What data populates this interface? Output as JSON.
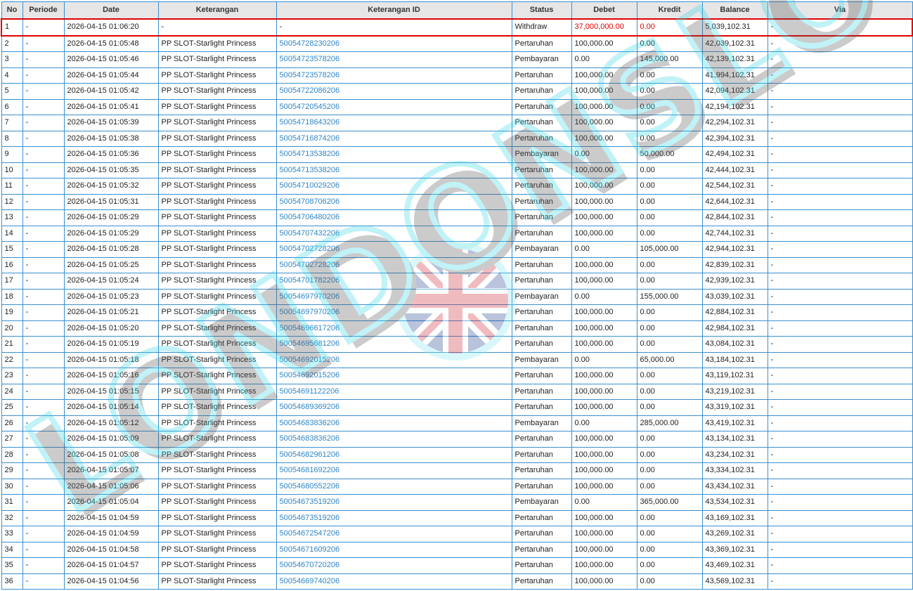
{
  "columns": [
    "No",
    "Periode",
    "Date",
    "Keterangan",
    "Keterangan ID",
    "Status",
    "Debet",
    "Kredit",
    "Balance",
    "Via"
  ],
  "rows": [
    {
      "no": "1",
      "periode": "-",
      "date": "2026-04-15 01:06:20",
      "ket": "-",
      "ket_id": "-",
      "status": "Withdraw",
      "debet": "37,000,000.00",
      "kredit": "0.00",
      "balance": "5,039,102.31",
      "via": "-"
    },
    {
      "no": "2",
      "periode": "-",
      "date": "2026-04-15 01:05:48",
      "ket": "PP SLOT-Starlight Princess",
      "ket_id": "50054728230206",
      "status": "Pertaruhan",
      "debet": "100,000.00",
      "kredit": "0.00",
      "balance": "42,039,102.31",
      "via": "-"
    },
    {
      "no": "3",
      "periode": "-",
      "date": "2026-04-15 01:05:46",
      "ket": "PP SLOT-Starlight Princess",
      "ket_id": "50054723578206",
      "status": "Pembayaran",
      "debet": "0.00",
      "kredit": "145,000.00",
      "balance": "42,139,102.31",
      "via": "-"
    },
    {
      "no": "4",
      "periode": "-",
      "date": "2026-04-15 01:05:44",
      "ket": "PP SLOT-Starlight Princess",
      "ket_id": "50054723578206",
      "status": "Pertaruhan",
      "debet": "100,000.00",
      "kredit": "0.00",
      "balance": "41,994,102.31",
      "via": "-"
    },
    {
      "no": "5",
      "periode": "-",
      "date": "2026-04-15 01:05:42",
      "ket": "PP SLOT-Starlight Princess",
      "ket_id": "50054722086206",
      "status": "Pertaruhan",
      "debet": "100,000.00",
      "kredit": "0.00",
      "balance": "42,094,102.31",
      "via": "-"
    },
    {
      "no": "6",
      "periode": "-",
      "date": "2026-04-15 01:05:41",
      "ket": "PP SLOT-Starlight Princess",
      "ket_id": "50054720545206",
      "status": "Pertaruhan",
      "debet": "100,000.00",
      "kredit": "0.00",
      "balance": "42,194,102.31",
      "via": "-"
    },
    {
      "no": "7",
      "periode": "-",
      "date": "2026-04-15 01:05:39",
      "ket": "PP SLOT-Starlight Princess",
      "ket_id": "50054718643206",
      "status": "Pertaruhan",
      "debet": "100,000.00",
      "kredit": "0.00",
      "balance": "42,294,102.31",
      "via": "-"
    },
    {
      "no": "8",
      "periode": "-",
      "date": "2026-04-15 01:05:38",
      "ket": "PP SLOT-Starlight Princess",
      "ket_id": "50054716874206",
      "status": "Pertaruhan",
      "debet": "100,000.00",
      "kredit": "0.00",
      "balance": "42,394,102.31",
      "via": "-"
    },
    {
      "no": "9",
      "periode": "-",
      "date": "2026-04-15 01:05:36",
      "ket": "PP SLOT-Starlight Princess",
      "ket_id": "50054713538206",
      "status": "Pembayaran",
      "debet": "0.00",
      "kredit": "50,000.00",
      "balance": "42,494,102.31",
      "via": "-"
    },
    {
      "no": "10",
      "periode": "-",
      "date": "2026-04-15 01:05:35",
      "ket": "PP SLOT-Starlight Princess",
      "ket_id": "50054713538206",
      "status": "Pertaruhan",
      "debet": "100,000.00",
      "kredit": "0.00",
      "balance": "42,444,102.31",
      "via": "-"
    },
    {
      "no": "11",
      "periode": "-",
      "date": "2026-04-15 01:05:32",
      "ket": "PP SLOT-Starlight Princess",
      "ket_id": "50054710029206",
      "status": "Pertaruhan",
      "debet": "100,000.00",
      "kredit": "0.00",
      "balance": "42,544,102.31",
      "via": "-"
    },
    {
      "no": "12",
      "periode": "-",
      "date": "2026-04-15 01:05:31",
      "ket": "PP SLOT-Starlight Princess",
      "ket_id": "50054708706206",
      "status": "Pertaruhan",
      "debet": "100,000.00",
      "kredit": "0.00",
      "balance": "42,644,102.31",
      "via": "-"
    },
    {
      "no": "13",
      "periode": "-",
      "date": "2026-04-15 01:05:29",
      "ket": "PP SLOT-Starlight Princess",
      "ket_id": "50054706480206",
      "status": "Pertaruhan",
      "debet": "100,000.00",
      "kredit": "0.00",
      "balance": "42,844,102.31",
      "via": "-"
    },
    {
      "no": "14",
      "periode": "-",
      "date": "2026-04-15 01:05:29",
      "ket": "PP SLOT-Starlight Princess",
      "ket_id": "50054707432206",
      "status": "Pertaruhan",
      "debet": "100,000.00",
      "kredit": "0.00",
      "balance": "42,744,102.31",
      "via": "-"
    },
    {
      "no": "15",
      "periode": "-",
      "date": "2026-04-15 01:05:28",
      "ket": "PP SLOT-Starlight Princess",
      "ket_id": "50054702728206",
      "status": "Pembayaran",
      "debet": "0.00",
      "kredit": "105,000.00",
      "balance": "42,944,102.31",
      "via": "-"
    },
    {
      "no": "16",
      "periode": "-",
      "date": "2026-04-15 01:05:25",
      "ket": "PP SLOT-Starlight Princess",
      "ket_id": "50054702728206",
      "status": "Pertaruhan",
      "debet": "100,000.00",
      "kredit": "0.00",
      "balance": "42,839,102.31",
      "via": "-"
    },
    {
      "no": "17",
      "periode": "-",
      "date": "2026-04-15 01:05:24",
      "ket": "PP SLOT-Starlight Princess",
      "ket_id": "50054701782206",
      "status": "Pertaruhan",
      "debet": "100,000.00",
      "kredit": "0.00",
      "balance": "42,939,102.31",
      "via": "-"
    },
    {
      "no": "18",
      "periode": "-",
      "date": "2026-04-15 01:05:23",
      "ket": "PP SLOT-Starlight Princess",
      "ket_id": "50054697970206",
      "status": "Pembayaran",
      "debet": "0.00",
      "kredit": "155,000.00",
      "balance": "43,039,102.31",
      "via": "-"
    },
    {
      "no": "19",
      "periode": "-",
      "date": "2026-04-15 01:05:21",
      "ket": "PP SLOT-Starlight Princess",
      "ket_id": "50054697970206",
      "status": "Pertaruhan",
      "debet": "100,000.00",
      "kredit": "0.00",
      "balance": "42,884,102.31",
      "via": "-"
    },
    {
      "no": "20",
      "periode": "-",
      "date": "2026-04-15 01:05:20",
      "ket": "PP SLOT-Starlight Princess",
      "ket_id": "50054696617206",
      "status": "Pertaruhan",
      "debet": "100,000.00",
      "kredit": "0.00",
      "balance": "42,984,102.31",
      "via": "-"
    },
    {
      "no": "21",
      "periode": "-",
      "date": "2026-04-15 01:05:19",
      "ket": "PP SLOT-Starlight Princess",
      "ket_id": "50054695681206",
      "status": "Pertaruhan",
      "debet": "100,000.00",
      "kredit": "0.00",
      "balance": "43,084,102.31",
      "via": "-"
    },
    {
      "no": "22",
      "periode": "-",
      "date": "2026-04-15 01:05:18",
      "ket": "PP SLOT-Starlight Princess",
      "ket_id": "50054692015206",
      "status": "Pembayaran",
      "debet": "0.00",
      "kredit": "65,000.00",
      "balance": "43,184,102.31",
      "via": "-"
    },
    {
      "no": "23",
      "periode": "-",
      "date": "2026-04-15 01:05:16",
      "ket": "PP SLOT-Starlight Princess",
      "ket_id": "50054692015206",
      "status": "Pertaruhan",
      "debet": "100,000.00",
      "kredit": "0.00",
      "balance": "43,119,102.31",
      "via": "-"
    },
    {
      "no": "24",
      "periode": "-",
      "date": "2026-04-15 01:05:15",
      "ket": "PP SLOT-Starlight Princess",
      "ket_id": "50054691122206",
      "status": "Pertaruhan",
      "debet": "100,000.00",
      "kredit": "0.00",
      "balance": "43,219,102.31",
      "via": "-"
    },
    {
      "no": "25",
      "periode": "-",
      "date": "2026-04-15 01:05:14",
      "ket": "PP SLOT-Starlight Princess",
      "ket_id": "50054689369206",
      "status": "Pertaruhan",
      "debet": "100,000.00",
      "kredit": "0.00",
      "balance": "43,319,102.31",
      "via": "-"
    },
    {
      "no": "26",
      "periode": "-",
      "date": "2026-04-15 01:05:12",
      "ket": "PP SLOT-Starlight Princess",
      "ket_id": "50054683836206",
      "status": "Pembayaran",
      "debet": "0.00",
      "kredit": "285,000.00",
      "balance": "43,419,102.31",
      "via": "-"
    },
    {
      "no": "27",
      "periode": "-",
      "date": "2026-04-15 01:05:09",
      "ket": "PP SLOT-Starlight Princess",
      "ket_id": "50054683836206",
      "status": "Pertaruhan",
      "debet": "100,000.00",
      "kredit": "0.00",
      "balance": "43,134,102.31",
      "via": "-"
    },
    {
      "no": "28",
      "periode": "-",
      "date": "2026-04-15 01:05:08",
      "ket": "PP SLOT-Starlight Princess",
      "ket_id": "50054682961206",
      "status": "Pertaruhan",
      "debet": "100,000.00",
      "kredit": "0.00",
      "balance": "43,234,102.31",
      "via": "-"
    },
    {
      "no": "29",
      "periode": "-",
      "date": "2026-04-15 01:05:07",
      "ket": "PP SLOT-Starlight Princess",
      "ket_id": "50054681692206",
      "status": "Pertaruhan",
      "debet": "100,000.00",
      "kredit": "0.00",
      "balance": "43,334,102.31",
      "via": "-"
    },
    {
      "no": "30",
      "periode": "-",
      "date": "2026-04-15 01:05:06",
      "ket": "PP SLOT-Starlight Princess",
      "ket_id": "50054680552206",
      "status": "Pertaruhan",
      "debet": "100,000.00",
      "kredit": "0.00",
      "balance": "43,434,102.31",
      "via": "-"
    },
    {
      "no": "31",
      "periode": "-",
      "date": "2026-04-15 01:05:04",
      "ket": "PP SLOT-Starlight Princess",
      "ket_id": "50054673519206",
      "status": "Pembayaran",
      "debet": "0.00",
      "kredit": "365,000.00",
      "balance": "43,534,102.31",
      "via": "-"
    },
    {
      "no": "32",
      "periode": "-",
      "date": "2026-04-15 01:04:59",
      "ket": "PP SLOT-Starlight Princess",
      "ket_id": "50054673519206",
      "status": "Pertaruhan",
      "debet": "100,000.00",
      "kredit": "0.00",
      "balance": "43,169,102.31",
      "via": "-"
    },
    {
      "no": "33",
      "periode": "-",
      "date": "2026-04-15 01:04:59",
      "ket": "PP SLOT-Starlight Princess",
      "ket_id": "50054672547206",
      "status": "Pertaruhan",
      "debet": "100,000.00",
      "kredit": "0.00",
      "balance": "43,269,102.31",
      "via": "-"
    },
    {
      "no": "34",
      "periode": "-",
      "date": "2026-04-15 01:04:58",
      "ket": "PP SLOT-Starlight Princess",
      "ket_id": "50054671609206",
      "status": "Pertaruhan",
      "debet": "100,000.00",
      "kredit": "0.00",
      "balance": "43,369,102.31",
      "via": "-"
    },
    {
      "no": "35",
      "periode": "-",
      "date": "2026-04-15 01:04:57",
      "ket": "PP SLOT-Starlight Princess",
      "ket_id": "50054670720206",
      "status": "Pertaruhan",
      "debet": "100,000.00",
      "kredit": "0.00",
      "balance": "43,469,102.31",
      "via": "-"
    },
    {
      "no": "36",
      "periode": "-",
      "date": "2026-04-15 01:04:56",
      "ket": "PP SLOT-Starlight Princess",
      "ket_id": "50054669740206",
      "status": "Pertaruhan",
      "debet": "100,000.00",
      "kredit": "0.00",
      "balance": "43,569,102.31",
      "via": "-"
    }
  ],
  "watermark": {
    "text": "LONDONSLOT",
    "icon": "uk-flag-icon",
    "text_color": "#7fe8f0",
    "shadow_color": "#555555"
  },
  "colors": {
    "border": "#3a8fd0",
    "header_bg": "#e6e6e6",
    "link": "#2f86c6",
    "highlight": "#e00000"
  }
}
